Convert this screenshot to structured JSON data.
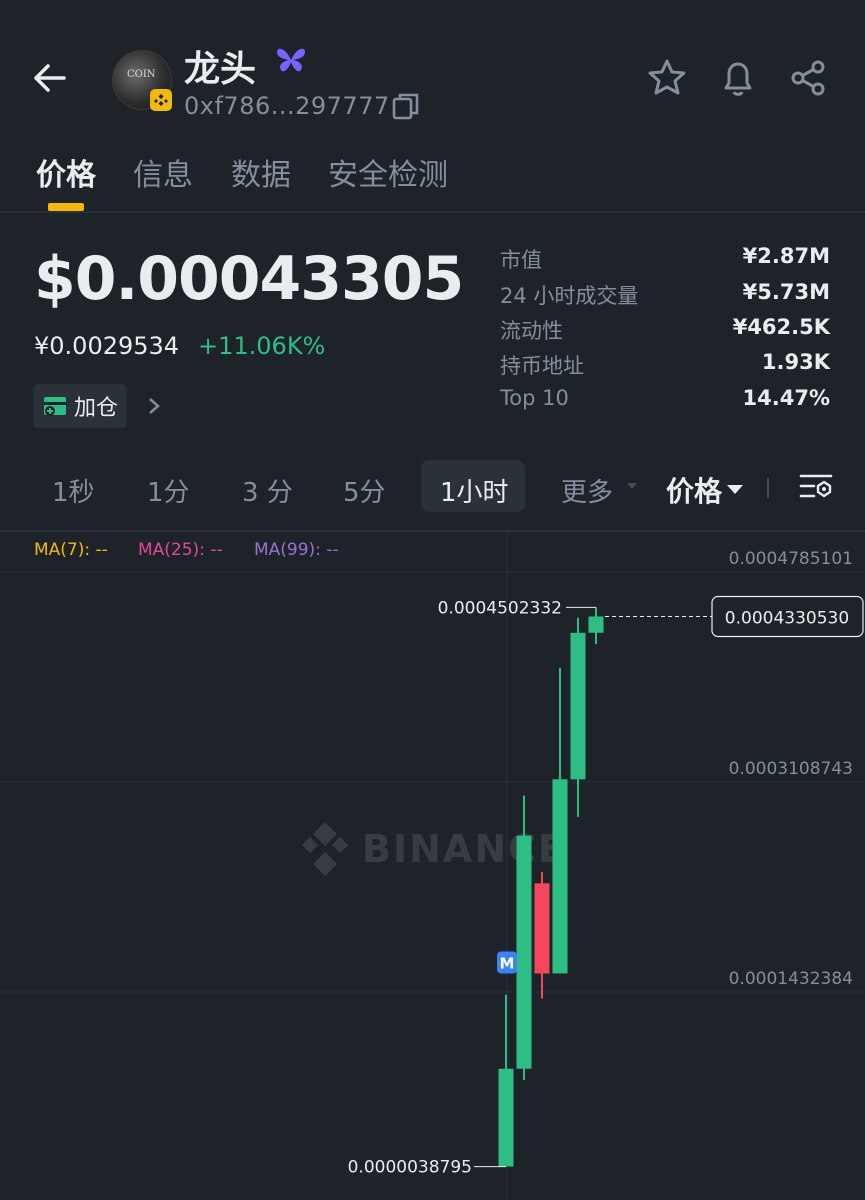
{
  "header": {
    "title": "龙头",
    "address": "0xf786...297777",
    "icons": [
      "back-arrow-icon",
      "butterfly-icon",
      "copy-icon",
      "star-icon",
      "bell-icon",
      "share-icon"
    ]
  },
  "avatar": {
    "text": "COIN"
  },
  "tabs": [
    {
      "label": "价格",
      "active": true
    },
    {
      "label": "信息",
      "active": false
    },
    {
      "label": "数据",
      "active": false
    },
    {
      "label": "安全检测",
      "active": false
    }
  ],
  "price": {
    "usd": "$0.00043305",
    "cny": "¥0.0029534",
    "change": "+11.06K%",
    "add_button": "加仓"
  },
  "stats": [
    {
      "label": "市值",
      "value": "¥2.87M"
    },
    {
      "label": "24 小时成交量",
      "value": "¥5.73M"
    },
    {
      "label": "流动性",
      "value": "¥462.5K"
    },
    {
      "label": "持币地址",
      "value": "1.93K"
    },
    {
      "label": "Top 10",
      "value": "14.47%"
    }
  ],
  "intervals": [
    "1秒",
    "1分",
    "3 分",
    "5分",
    "1小时",
    "更多"
  ],
  "active_interval": "1小时",
  "price_select": "价格",
  "ma_legend": [
    {
      "label": "MA(7): --",
      "color": "#f0b90b"
    },
    {
      "label": "MA(25): --",
      "color": "#e0479e"
    },
    {
      "label": "MA(99): --",
      "color": "#9b6fd0"
    }
  ],
  "colors": {
    "up": "#2ebd85",
    "down": "#f6465d",
    "accent": "#f0b90b"
  },
  "chart_data": {
    "type": "candlestick",
    "y_ticks": [
      "0.0004785101",
      "0.0003108743",
      "0.0001432384"
    ],
    "y_tick_values": [
      0.0004785101,
      0.0003108743,
      0.0001432384
    ],
    "high_label": "0.0004502332",
    "low_label": "0.0000038795",
    "current_label": "0.0004330530",
    "candles": [
      {
        "open": 3.8795e-06,
        "close": 8.2e-05,
        "high": 0.000141,
        "low": 3.8795e-06
      },
      {
        "open": 8.2e-05,
        "close": 0.000268,
        "high": 0.0003,
        "low": 7.3e-05
      },
      {
        "open": 0.00023,
        "close": 0.000158,
        "high": 0.000239,
        "low": 0.000138
      },
      {
        "open": 0.000158,
        "close": 0.000313,
        "high": 0.000402,
        "low": 0.000158
      },
      {
        "open": 0.000313,
        "close": 0.00043,
        "high": 0.000442,
        "low": 0.000283
      },
      {
        "open": 0.00043,
        "close": 0.000443,
        "high": 0.0004502332,
        "low": 0.000421
      }
    ],
    "marker": "M",
    "watermark": "BINANCE"
  }
}
